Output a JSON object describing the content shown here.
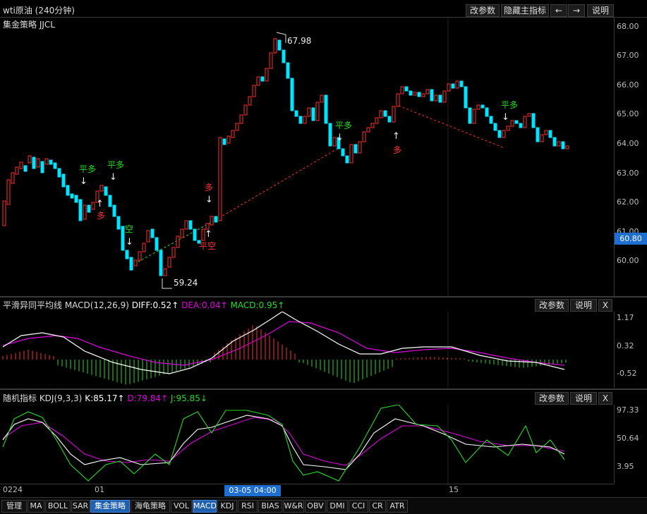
{
  "window": {
    "title": "wti原油 (240分钟)",
    "buttons": {
      "params": "改参数",
      "hide_main": "隐藏主指标",
      "prev": "←",
      "next": "→",
      "help": "说明"
    }
  },
  "main_panel": {
    "indicator_label": "集金策略 JJCL",
    "price_axis": [
      "68.00",
      "67.00",
      "66.00",
      "65.00",
      "64.00",
      "63.00",
      "62.00",
      "61.00",
      "60.00"
    ],
    "current_price": "60.80",
    "high_label": "67.98",
    "low_label": "59.24",
    "signals": [
      "平多",
      "平多",
      "多",
      "空",
      "多",
      "平空",
      "平多",
      "多",
      "平多"
    ]
  },
  "macd_panel": {
    "title": "平滑异同平均线 MACD(12,26,9)",
    "diff": "DIFF:0.52↑",
    "dea": "DEA:0.04↑",
    "macd": "MACD:0.95↑",
    "axis": [
      "1.17",
      "0.32",
      "-0.52"
    ],
    "buttons": {
      "params": "改参数",
      "help": "说明",
      "close": "X"
    }
  },
  "kdj_panel": {
    "title": "随机指标 KDJ(9,3,3)",
    "k": "K:85.17↑",
    "d": "D:79.84↑",
    "j": "J:95.85↓",
    "axis": [
      "97.33",
      "50.64",
      "3.95"
    ],
    "buttons": {
      "params": "改参数",
      "help": "说明",
      "close": "X"
    }
  },
  "time_axis": {
    "labels": [
      "0224",
      "01",
      "15"
    ],
    "cursor_label": "03-05 04:00"
  },
  "tabs": [
    "管理",
    "MA",
    "BOLL",
    "SAR",
    "集金策略",
    "海龟策略",
    "VOL",
    "MACD",
    "KDJ",
    "RSI",
    "BIAS",
    "W&R",
    "OBV",
    "DMI",
    "CCI",
    "CR",
    "ATR"
  ],
  "active_tabs": [
    "集金策略",
    "MACD"
  ],
  "colors": {
    "up": "#ff3030",
    "down": "#00e5ff",
    "green": "#22dd22",
    "magenta": "#e000e0",
    "cursor": "#1e6fd0"
  }
}
